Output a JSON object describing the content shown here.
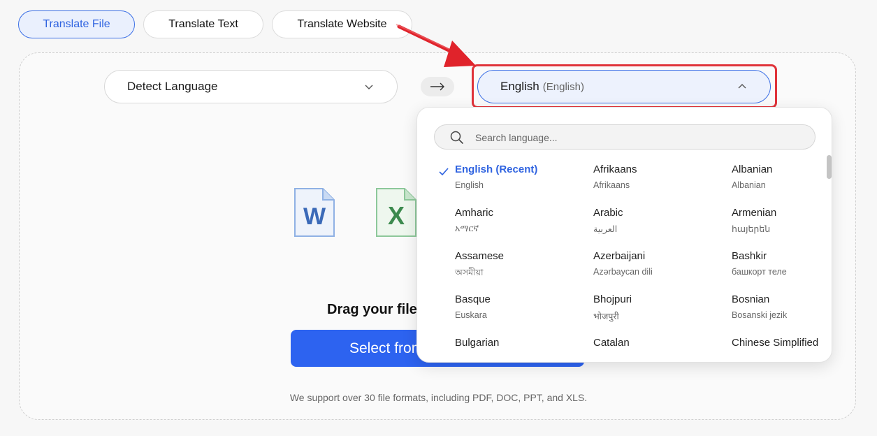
{
  "tabs": {
    "translate_file": "Translate File",
    "translate_text": "Translate Text",
    "translate_website": "Translate Website"
  },
  "source_language": {
    "label": "Detect Language"
  },
  "target_language": {
    "label": "English",
    "native": "(English)"
  },
  "upload": {
    "file_icons": [
      "word-icon",
      "excel-icon"
    ],
    "drag_text": "Drag your file",
    "select_button": "Select from",
    "support_text": "We support over 30 file formats, including PDF, DOC, PPT, and XLS."
  },
  "dropdown": {
    "search_placeholder": "Search language...",
    "languages": [
      {
        "name": "English (Recent)",
        "native": "English"
      },
      {
        "name": "Afrikaans",
        "native": "Afrikaans"
      },
      {
        "name": "Albanian",
        "native": "Albanian"
      },
      {
        "name": "Amharic",
        "native": "አማርኛ"
      },
      {
        "name": "Arabic",
        "native": "العربية"
      },
      {
        "name": "Armenian",
        "native": "հայերեն"
      },
      {
        "name": "Assamese",
        "native": "অসমীয়া"
      },
      {
        "name": "Azerbaijani",
        "native": "Azərbaycan dili"
      },
      {
        "name": "Bashkir",
        "native": "башкорт теле"
      },
      {
        "name": "Basque",
        "native": "Euskara"
      },
      {
        "name": "Bhojpuri",
        "native": "भोजपुरी"
      },
      {
        "name": "Bosnian",
        "native": "Bosanski jezik"
      },
      {
        "name": "Bulgarian",
        "native": ""
      },
      {
        "name": "Catalan",
        "native": ""
      },
      {
        "name": "Chinese Simplified",
        "native": ""
      }
    ]
  },
  "colors": {
    "accent": "#2d63f0",
    "highlight": "#e0333a"
  }
}
